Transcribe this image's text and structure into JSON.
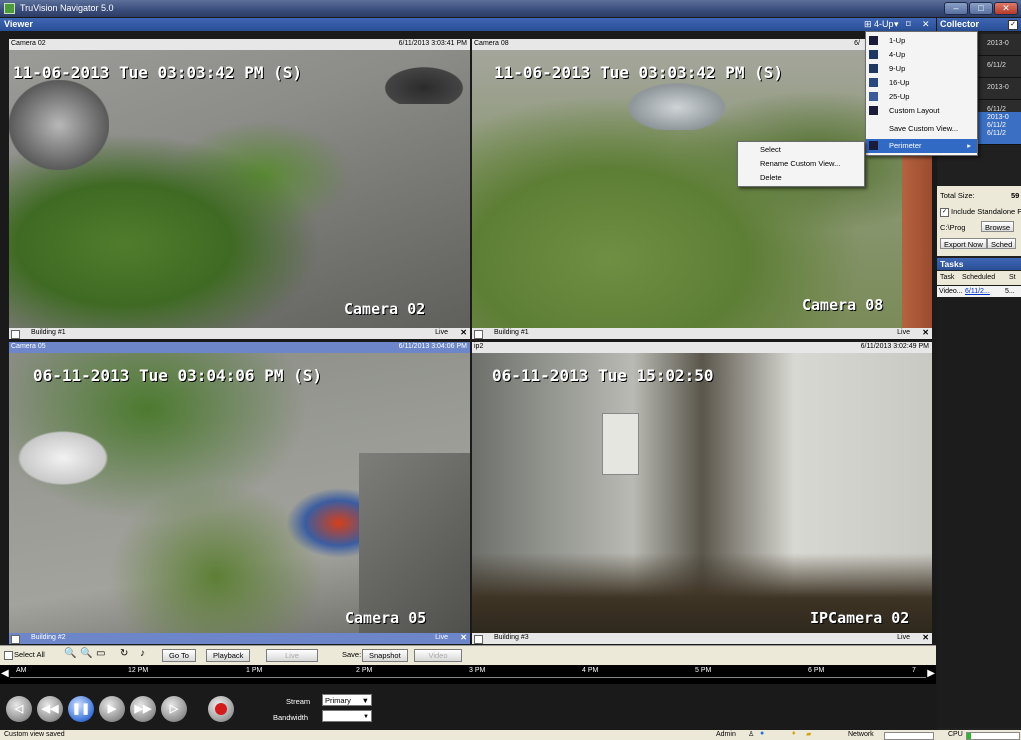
{
  "window": {
    "title": "TruVision Navigator 5.0"
  },
  "viewer": {
    "header_label": "Viewer",
    "layout_label": "4-Up",
    "dropdown_arrow": "▾",
    "pin_glyph": "⌑",
    "close_glyph": "✕"
  },
  "layout_menu": {
    "items": [
      {
        "label": "1-Up"
      },
      {
        "label": "4-Up"
      },
      {
        "label": "9-Up"
      },
      {
        "label": "16-Up"
      },
      {
        "label": "25-Up"
      },
      {
        "label": "Custom Layout"
      },
      {
        "label": "Save Custom View..."
      },
      {
        "label": "Perimeter",
        "arrow": "▸"
      }
    ]
  },
  "context_menu": {
    "items": [
      "Select",
      "Rename Custom View...",
      "Delete"
    ]
  },
  "panes": [
    {
      "name": "Camera 02",
      "datetime": "6/11/2013 3:03:41 PM",
      "osd": "11-06-2013 Tue 03:03:42 PM (S)",
      "camera_label": "Camera 02",
      "site": "Building #1",
      "status": "Live"
    },
    {
      "name": "Camera 08",
      "datetime": "6/",
      "osd": "11-06-2013 Tue 03:03:42 PM (S)",
      "camera_label": "Camera 08",
      "site": "Building #1",
      "status": "Live"
    },
    {
      "name": "Camera 05",
      "datetime": "6/11/2013 3:04:06 PM",
      "osd": "06-11-2013 Tue 03:04:06 PM (S)",
      "camera_label": "Camera 05",
      "site": "Building #2",
      "status": "Live"
    },
    {
      "name": "ip2",
      "datetime": "6/11/2013 3:02:49 PM",
      "osd": "06-11-2013 Tue 15:02:50",
      "camera_label": "IPCamera 02",
      "site": "Building #3",
      "status": "Live"
    }
  ],
  "collector": {
    "header_label": "Collector",
    "items": [
      "2013-0",
      "6/11/2",
      "2013-0",
      "6/11/2",
      "2013-0\n6/11/2\n6/11/2"
    ],
    "total_size_label": "Total Size:",
    "total_size_value": "59",
    "include_label": "Include Standalone Pl",
    "path_value": "C:\\Prog",
    "browse_label": "Browse",
    "export_label": "Export Now",
    "schedule_label": "Sched"
  },
  "tasks": {
    "header_label": "Tasks",
    "tabs": [
      "Task",
      "Scheduled",
      "St"
    ],
    "row": [
      "Video...",
      "6/11/2...",
      "5..."
    ]
  },
  "toolbar": {
    "select_all": "Select All",
    "goto": "Go To",
    "playback": "Playback",
    "live": "Live",
    "save_label": "Save:",
    "snapshot": "Snapshot",
    "video": "Video"
  },
  "timeline": {
    "ticks": [
      "AM",
      "12 PM",
      "1 PM",
      "2 PM",
      "3 PM",
      "4 PM",
      "5 PM",
      "6 PM",
      "7"
    ]
  },
  "playback": {
    "stream_label": "Stream",
    "stream_value": "Primary",
    "bandwidth_label": "Bandwidth",
    "bandwidth_value": ""
  },
  "status": {
    "message": "Custom view saved",
    "user": "Admin",
    "network_label": "Network",
    "cpu_label": "CPU"
  }
}
